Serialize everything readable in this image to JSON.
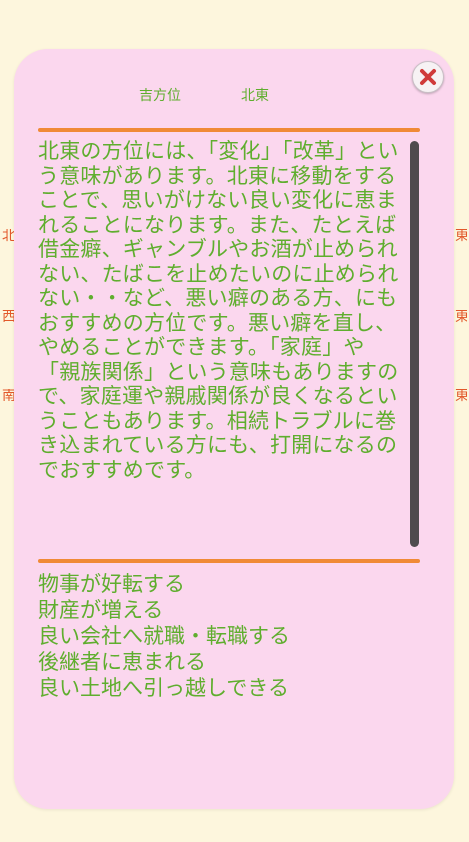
{
  "background": {
    "left": [
      "北",
      "西",
      "南"
    ],
    "right": [
      "東",
      "東",
      "東"
    ]
  },
  "header": {
    "category": "吉方位",
    "direction": "北東"
  },
  "description": "北東の方位には、「変化」「改革」という意味があります。北東に移動をすることで、思いがけない良い変化に恵まれることになります。また、たとえば借金癖、ギャンブルやお酒が止められない、たばこを止めたいのに止められない・・など、悪い癖のある方、にもおすすめの方位です。悪い癖を直し、やめることができます。「家庭」や「親族関係」という意味もありますので、家庭運や親戚関係が良くなるということもあります。相続トラブルに巻き込まれている方にも、打開になるのでおすすめです。",
  "benefits": [
    "物事が好転する",
    "財産が増える",
    "良い会社へ就職・転職する",
    "後継者に恵まれる",
    "良い土地へ引っ越しできる"
  ],
  "colors": {
    "accent_text": "#5fae2e",
    "divider": "#f08a36",
    "card": "#fbd7ee",
    "page": "#fdf6dd",
    "bg_label": "#e2582a"
  },
  "icons": {
    "close": "close-icon"
  }
}
